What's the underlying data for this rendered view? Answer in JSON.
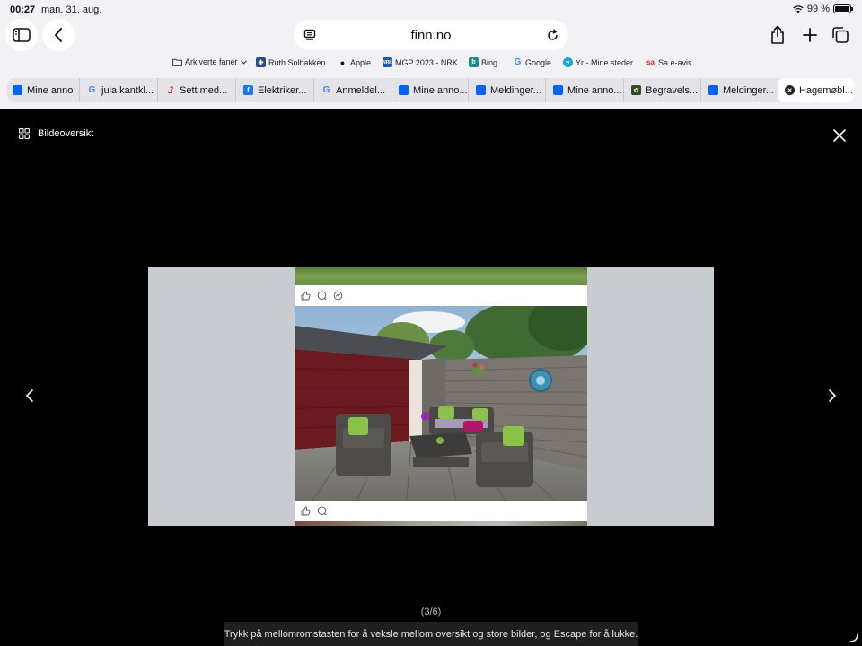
{
  "status_bar": {
    "time": "00:27",
    "date": "man. 31. aug.",
    "battery": "99 %",
    "battery_level": 0.99
  },
  "toolbar": {
    "address": "finn.no"
  },
  "favorites": [
    {
      "label": "Arkiverte faner",
      "icon": "folder-icon"
    },
    {
      "label": "Ruth Solbakken",
      "icon": "ruth-solbakken-icon",
      "color": "#2a4d8f"
    },
    {
      "label": "Apple",
      "icon": "apple-icon"
    },
    {
      "label": "MGP 2023 - NRK",
      "icon": "nrk-icon",
      "color": "#1b5fb5"
    },
    {
      "label": "Bing",
      "icon": "bing-icon",
      "color": "#1a8c8c"
    },
    {
      "label": "Google",
      "icon": "google-icon"
    },
    {
      "label": "Yr - Mine steder",
      "icon": "yr-icon",
      "color": "#17a3d9"
    },
    {
      "label": "Sa e-avis",
      "icon": "sa-icon",
      "color": "#d52121"
    }
  ],
  "tabs": [
    {
      "label": "Mine anno",
      "icon": "finn-icon"
    },
    {
      "label": "jula kantkl...",
      "icon": "google-icon"
    },
    {
      "label": "Sett med...",
      "icon": "joker-icon"
    },
    {
      "label": "Elektriker...",
      "icon": "facebook-icon"
    },
    {
      "label": "Anmeldel...",
      "icon": "google-icon"
    },
    {
      "label": "Mine anno...",
      "icon": "finn-icon"
    },
    {
      "label": "Meldinger...",
      "icon": "finn-icon"
    },
    {
      "label": "Mine anno...",
      "icon": "finn-icon"
    },
    {
      "label": "Begravels...",
      "icon": "begravelse-icon"
    },
    {
      "label": "Meldinger...",
      "icon": "finn-icon"
    },
    {
      "label": "Hagemøbl...",
      "icon": "close-tab-icon",
      "active": true
    }
  ],
  "lightbox": {
    "overview_label": "Bildeoversikt",
    "counter": "(3/6)",
    "hint": "Trykk på mellomromstasten for å veksle mellom oversikt og store bilder, og Escape for å lukke."
  },
  "colors": {
    "accent": "#0063fb",
    "stage": "#c8ccd0",
    "hint_bg": "#1f1f1f"
  }
}
